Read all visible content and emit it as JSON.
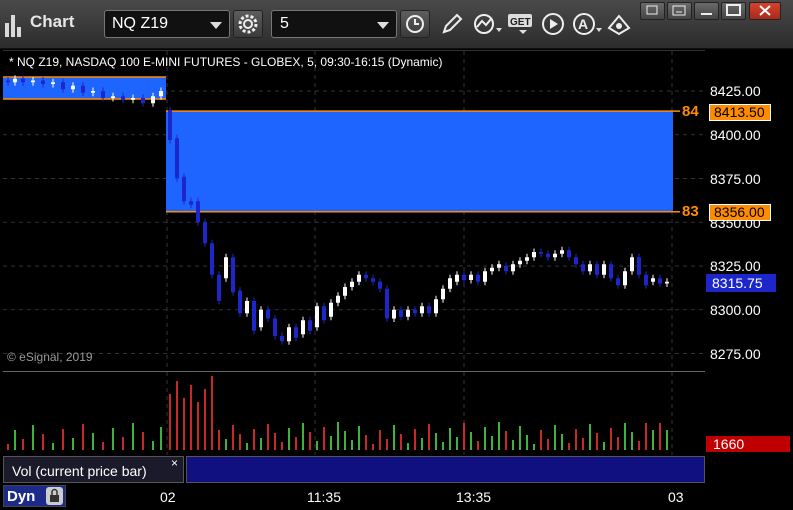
{
  "app": {
    "title": "Chart"
  },
  "toolbar": {
    "symbol": "NQ Z19",
    "interval": "5",
    "icons": [
      "settings-gear-icon",
      "clock-icon",
      "pencil-icon",
      "chart-line-icon",
      "get-data-icon",
      "play-icon",
      "alert-icon",
      "compass-icon"
    ],
    "window_icons": [
      "restore-icon",
      "minimize-icon",
      "maximize-icon",
      "close-icon"
    ]
  },
  "chart": {
    "info": "* NQ Z19, NASDAQ 100 E-MINI FUTURES - GLOBEX, 5, 09:30-16:15 (Dynamic)",
    "copyright": "© eSignal, 2019",
    "price_labels": [
      "8425.00",
      "8400.00",
      "8375.00",
      "8350.00",
      "8325.00",
      "8300.00",
      "8275.00"
    ],
    "alerts": [
      {
        "marker": "84",
        "price": "8413.50"
      },
      {
        "marker": "83",
        "price": "8356.00"
      }
    ],
    "last_price": "8315.75",
    "colors": {
      "up": "#ffffff",
      "down": "#1d27c9",
      "zone": "#1e64ff",
      "alert": "#ff8c00",
      "vol_up": "#3cb43c",
      "vol_down": "#c82828"
    }
  },
  "volume": {
    "study_label": "Vol (current price bar)",
    "close_label": "×",
    "current_value": "1660"
  },
  "time_axis": {
    "labels": [
      "02",
      "11:35",
      "13:35",
      "03"
    ]
  },
  "bottom": {
    "dyn_label": "Dyn"
  }
}
